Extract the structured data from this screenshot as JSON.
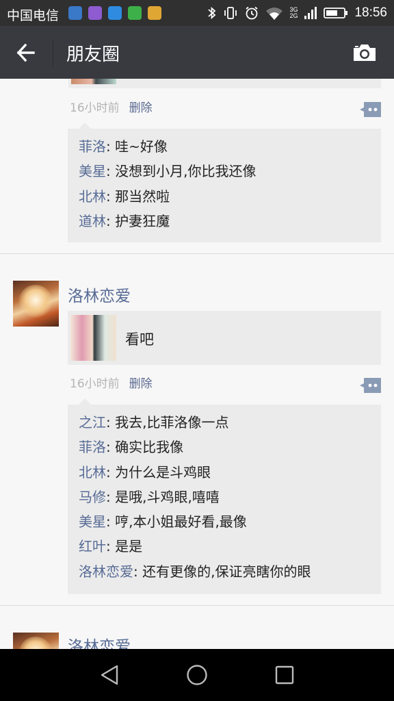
{
  "status_bar": {
    "carrier": "中国电信",
    "time": "18:56",
    "net_top": "3G",
    "net_bottom": "2G",
    "app_icon_colors": [
      "#3a78c8",
      "#8e5bd0",
      "#2f8be0",
      "#3eb049",
      "#e0a634"
    ]
  },
  "title_bar": {
    "title": "朋友圈"
  },
  "posts": [
    {
      "time": "16小时前",
      "delete_label": "删除",
      "comments": [
        {
          "name": "菲洛",
          "text": ": 哇~好像"
        },
        {
          "name": "美星",
          "text": ": 没想到小月,你比我还像"
        },
        {
          "name": "北林",
          "text": ": 那当然啦"
        },
        {
          "name": "道林",
          "text": ": 护妻狂魔"
        }
      ]
    },
    {
      "author": "洛林恋爱",
      "share_text": "看吧",
      "time": "16小时前",
      "delete_label": "删除",
      "comments": [
        {
          "name": "之江",
          "text": ": 我去,比菲洛像一点"
        },
        {
          "name": "菲洛",
          "text": ": 确实比我像"
        },
        {
          "name": "北林",
          "text": ": 为什么是斗鸡眼"
        },
        {
          "name": "马修",
          "text": ": 是哦,斗鸡眼,嘻嘻"
        },
        {
          "name": "美星",
          "text": ": 哼,本小姐最好看,最像"
        },
        {
          "name": "红叶",
          "text": ": 是是"
        },
        {
          "name": "洛林恋爱",
          "text": ": 还有更像的,保证亮瞎你的眼"
        }
      ]
    },
    {
      "author": "洛林恋爱"
    }
  ],
  "colors": {
    "name_link": "#576b95",
    "comment_bg": "#ebebeb",
    "title_bar_bg": "#393a3f"
  },
  "icons": {
    "back": "arrow-left-icon",
    "camera": "camera-icon",
    "comment": "comment-icon",
    "nav_back": "triangle-back-icon",
    "nav_home": "circle-home-icon",
    "nav_recents": "square-recents-icon"
  }
}
